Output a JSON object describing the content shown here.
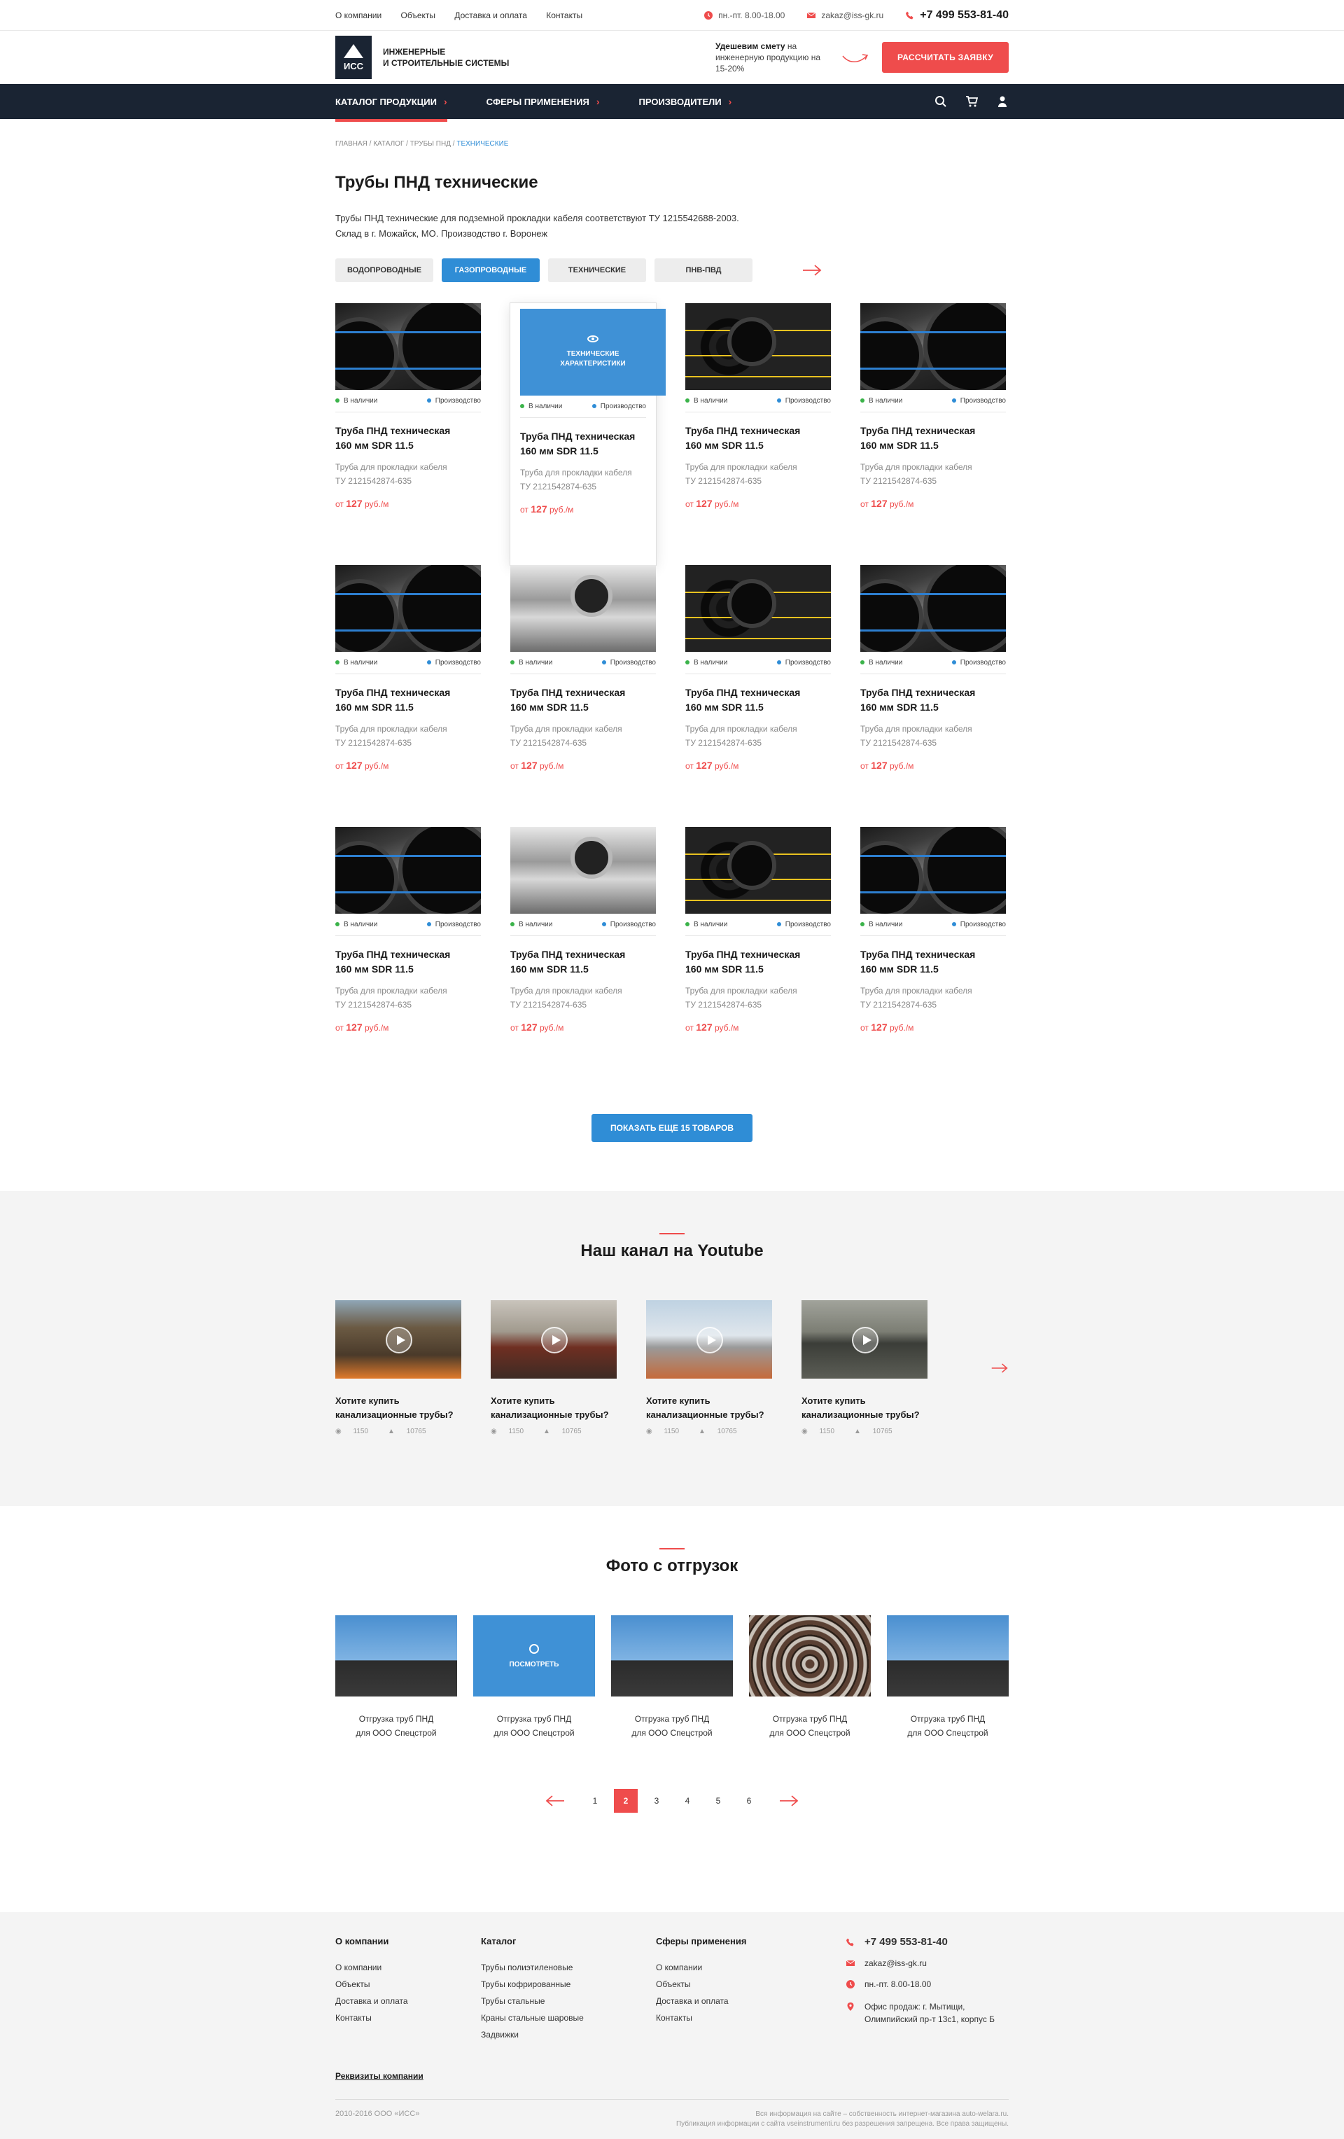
{
  "topbar": {
    "nav": [
      "О компании",
      "Объекты",
      "Доставка и оплата",
      "Контакты"
    ],
    "hours": "пн.-пт. 8.00-18.00",
    "email": "zakaz@iss-gk.ru",
    "phone": "+7 499 553-81-40"
  },
  "header": {
    "logo_mark": "ИСС",
    "logo_line1": "Инженерные",
    "logo_line2": "и строительные системы",
    "promo_bold": "Удешевим смету",
    "promo_rest": "на инженерную продукцию на 15-20%",
    "cta": "Рассчитать заявку"
  },
  "mainnav": {
    "items": [
      "Каталог продукции",
      "Сферы применения",
      "Производители"
    ],
    "icons": [
      "search-icon",
      "cart-icon",
      "user-icon"
    ]
  },
  "breadcrumbs": {
    "items": [
      "Главная",
      "Каталог",
      "Трубы ПНД"
    ],
    "current": "Технические",
    "sep": " / "
  },
  "page": {
    "title": "Трубы ПНД технические",
    "desc_line1": "Трубы ПНД технические для подземной прокладки кабеля соответствуют ТУ 1215542688-2003.",
    "desc_line2": "Склад в г. Можайск, МО. Производство г. Воронеж"
  },
  "filters": [
    "Водопроводные",
    "Газопроводные",
    "Технические",
    "ПНВ-ПВД"
  ],
  "filters_active": 1,
  "product_common": {
    "stock": "В наличии",
    "production": "Производство",
    "title_l1": "Труба ПНД техническая",
    "title_l2": "160 мм SDR 11.5",
    "desc_l1": "Труба для прокладки кабеля",
    "desc_l2": "ТУ 2121542874-635",
    "price_prefix": "от",
    "price": "127",
    "price_unit": "руб./м",
    "hover_label_l1": "Технические",
    "hover_label_l2": "характеристики"
  },
  "products": [
    {
      "img": "a"
    },
    {
      "img": "hover"
    },
    {
      "img": "c"
    },
    {
      "img": "a"
    },
    {
      "img": "a"
    },
    {
      "img": "b"
    },
    {
      "img": "c"
    },
    {
      "img": "a"
    },
    {
      "img": "a"
    },
    {
      "img": "b"
    },
    {
      "img": "c"
    },
    {
      "img": "a"
    }
  ],
  "more_button": "Показать еще 15 товаров",
  "youtube": {
    "title": "Наш канал на Youtube",
    "videos": [
      {
        "title_l1": "Хотите купить",
        "title_l2": "канализационные трубы?",
        "views": "1150",
        "likes": "10765"
      },
      {
        "title_l1": "Хотите купить",
        "title_l2": "канализационные трубы?",
        "views": "1150",
        "likes": "10765"
      },
      {
        "title_l1": "Хотите купить",
        "title_l2": "канализационные трубы?",
        "views": "1150",
        "likes": "10765"
      },
      {
        "title_l1": "Хотите купить",
        "title_l2": "канализационные трубы?",
        "views": "1150",
        "likes": "10765"
      }
    ]
  },
  "photos": {
    "title": "Фото с отгрузок",
    "hover_label": "Посмотреть",
    "items": [
      {
        "cap_l1": "Отгрузка труб ПНД",
        "cap_l2": "для ООО Спецстрой",
        "img": "sky"
      },
      {
        "cap_l1": "Отгрузка труб ПНД",
        "cap_l2": "для ООО Спецстрой",
        "img": "hover"
      },
      {
        "cap_l1": "Отгрузка труб ПНД",
        "cap_l2": "для ООО Спецстрой",
        "img": "sky"
      },
      {
        "cap_l1": "Отгрузка труб ПНД",
        "cap_l2": "для ООО Спецстрой",
        "img": "rust"
      },
      {
        "cap_l1": "Отгрузка труб ПНД",
        "cap_l2": "для ООО Спецстрой",
        "img": "sky"
      }
    ]
  },
  "pager": {
    "pages": [
      "1",
      "2",
      "3",
      "4",
      "5",
      "6"
    ],
    "active": 1
  },
  "footer": {
    "col1": {
      "title": "О компании",
      "items": [
        "О компании",
        "Объекты",
        "Доставка и оплата",
        "Контакты"
      ]
    },
    "col2": {
      "title": "Каталог",
      "items": [
        "Трубы полиэтиленовые",
        "Трубы кофрированные",
        "Трубы стальные",
        "Краны стальные шаровые",
        "Задвижки"
      ]
    },
    "col3": {
      "title": "Сферы применения",
      "items": [
        "О компании",
        "Объекты",
        "Доставка и оплата",
        "Контакты"
      ]
    },
    "phone": "+7 499 553-81-40",
    "email": "zakaz@iss-gk.ru",
    "hours": "пн.-пт. 8.00-18.00",
    "address_l1": "Офис продаж: г. Мытищи,",
    "address_l2": "Олимпийский пр-т 13с1, корпус Б",
    "requisites": "Реквизиты компании",
    "copyright": "2010-2016 ООО «ИСС»",
    "legal_l1": "Вся информация на сайте – собственность интернет-магазина auto-welara.ru.",
    "legal_l2": "Публикация информации с сайта vseinstrumenti.ru без разрешения запрещена. Все права защищены."
  },
  "colors": {
    "accent": "#ef4c4c",
    "blue": "#2f8dd6",
    "navy": "#1a2433"
  }
}
